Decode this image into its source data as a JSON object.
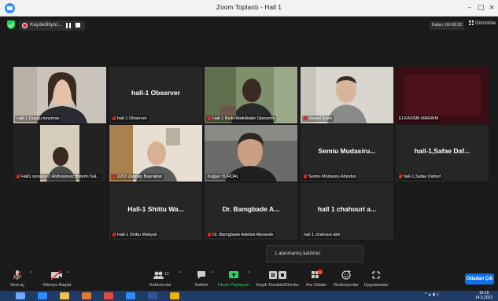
{
  "window": {
    "title": "Zoom Toplantı - Hall 1",
    "minimize": "–",
    "maximize": "□",
    "close": "×"
  },
  "status": {
    "recording_label": "Kaydediliyor...",
    "timer_label": "Kalan: 09:08:32",
    "view_label": "Görüntüle"
  },
  "tiles": {
    "t1": {
      "label": "Hall-1 Duygu tunçman"
    },
    "t2": {
      "name": "hall-1 Observer",
      "label": "hall-1 Observer"
    },
    "t3": {
      "label": "Hall-1 Bello Abdulkabir Opeyemi"
    },
    "t4": {
      "label": "Veysel Esen"
    },
    "t5": {
      "label": "ELKASSBI MARAIM"
    },
    "t6": {
      "label": "Hall1 session 2 Abdulazeez Bidemi Sal..."
    },
    "t7": {
      "label": "2203 Zeynep Bayraktar"
    },
    "t8": {
      "label": "Kağan YURDAL"
    },
    "t9": {
      "name": "Semiu Mudasiru...",
      "label": "Semiu Mudasiru Abiodun"
    },
    "t10": {
      "name": "hall-1,Safae Daf...",
      "label": "hall-1,Safae Dafouf"
    },
    "t11": {
      "name": "Hall-1 Shittu Wa...",
      "label": "Hall-1 Shittu Waliyah"
    },
    "t12": {
      "name": "Dr. Bamgbade A...",
      "label": "Dr. Bamgbade Adebisi Abosede"
    },
    "t13": {
      "name": "hall 1 chahouri a...",
      "label": "hall 1 chahouri abir"
    }
  },
  "notice": "1 atanmamış katılımcı",
  "toolbar": {
    "audio": "Sesi aç",
    "video": "Videoyu Başlat",
    "participants": "Katılımcılar",
    "participants_count": "13",
    "chat": "Sohbet",
    "share": "Ekran Paylaşımı",
    "pause_rec": "Kaydı Duraklat/Durdur",
    "breakout": "Ara Odalar",
    "breakout_badge": "1",
    "reactions": "Reaksiyonlar",
    "apps": "Uygulamalar",
    "leave": "Odadan Çık"
  },
  "taskbar": {
    "time": "16:15",
    "date": "14.5.2022"
  },
  "colors": {
    "accent": "#0e72ed",
    "active_speaker": "#c5e32b",
    "share_green": "#23d959",
    "mute_red": "#e02828"
  }
}
